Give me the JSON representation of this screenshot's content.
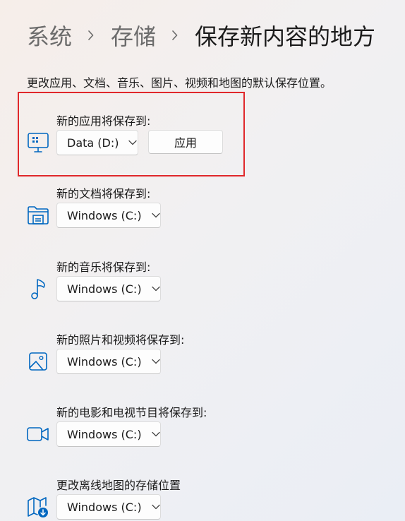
{
  "breadcrumb": {
    "items": [
      "系统",
      "存储"
    ],
    "current": "保存新内容的地方"
  },
  "description": "更改应用、文档、音乐、图片、视频和地图的默认保存位置。",
  "colors": {
    "accent": "#0067c0",
    "highlight_border": "#e0282b"
  },
  "sections": [
    {
      "label": "新的应用将保存到:",
      "icon": "apps-monitor-icon",
      "value": "Data (D:)",
      "apply_label": "应用"
    },
    {
      "label": "新的文档将保存到:",
      "icon": "folder-document-icon",
      "value": "Windows (C:)"
    },
    {
      "label": "新的音乐将保存到:",
      "icon": "music-note-icon",
      "value": "Windows (C:)"
    },
    {
      "label": "新的照片和视频将保存到:",
      "icon": "image-icon",
      "value": "Windows (C:)"
    },
    {
      "label": "新的电影和电视节目将保存到:",
      "icon": "video-camera-icon",
      "value": "Windows (C:)"
    },
    {
      "label": "更改离线地图的存储位置",
      "icon": "map-download-icon",
      "value": "Windows (C:)"
    }
  ]
}
